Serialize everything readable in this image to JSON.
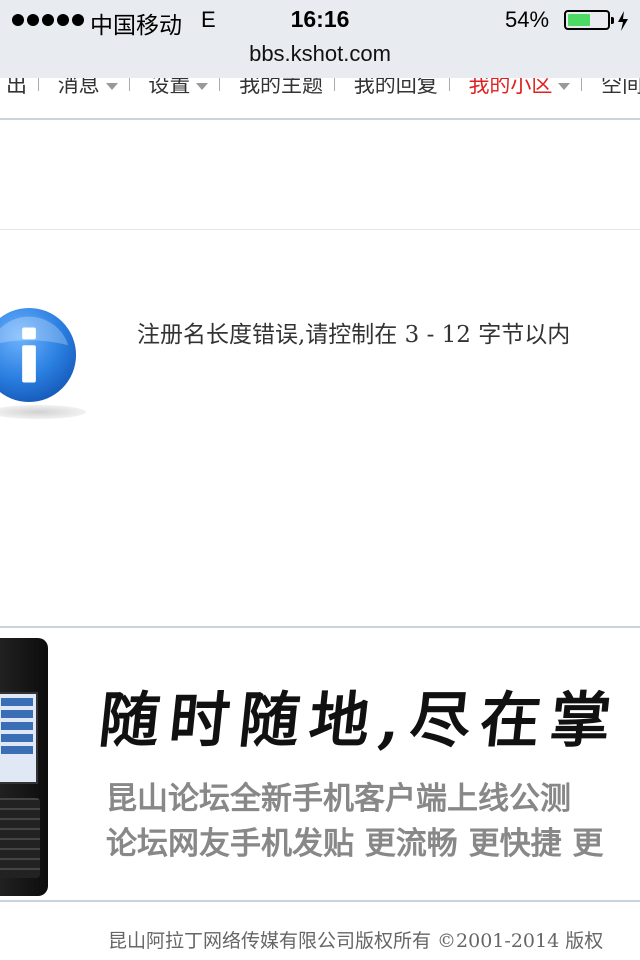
{
  "status_bar": {
    "carrier": "中国移动",
    "network": "E",
    "time": "16:16",
    "battery_percent": "54%",
    "battery_level": 0.54
  },
  "url_bar": {
    "url": "bbs.kshot.com"
  },
  "nav": {
    "items": [
      {
        "label": "出",
        "has_dropdown": false,
        "active": false
      },
      {
        "label": "消息",
        "has_dropdown": true,
        "active": false
      },
      {
        "label": "设置",
        "has_dropdown": true,
        "active": false
      },
      {
        "label": "我的主题",
        "has_dropdown": false,
        "active": false
      },
      {
        "label": "我的回复",
        "has_dropdown": false,
        "active": false
      },
      {
        "label": "我的小区",
        "has_dropdown": true,
        "active": true
      },
      {
        "label": "空间",
        "has_dropdown": false,
        "active": false
      }
    ]
  },
  "message": {
    "icon": "info-icon",
    "text": "注册名长度错误,请控制在 3 - 12 字节以内"
  },
  "banner": {
    "slogan": "随时随地,尽在掌",
    "line1": "昆山论坛全新手机客户端上线公测",
    "line2": "论坛网友手机发贴 更流畅 更快捷 更"
  },
  "footer": {
    "text": "昆山阿拉丁网络传媒有限公司版权所有 ©2001-2014 版权"
  },
  "colors": {
    "accent_red": "#e02020",
    "info_blue": "#2a7fe0",
    "battery_green": "#4cd964"
  }
}
